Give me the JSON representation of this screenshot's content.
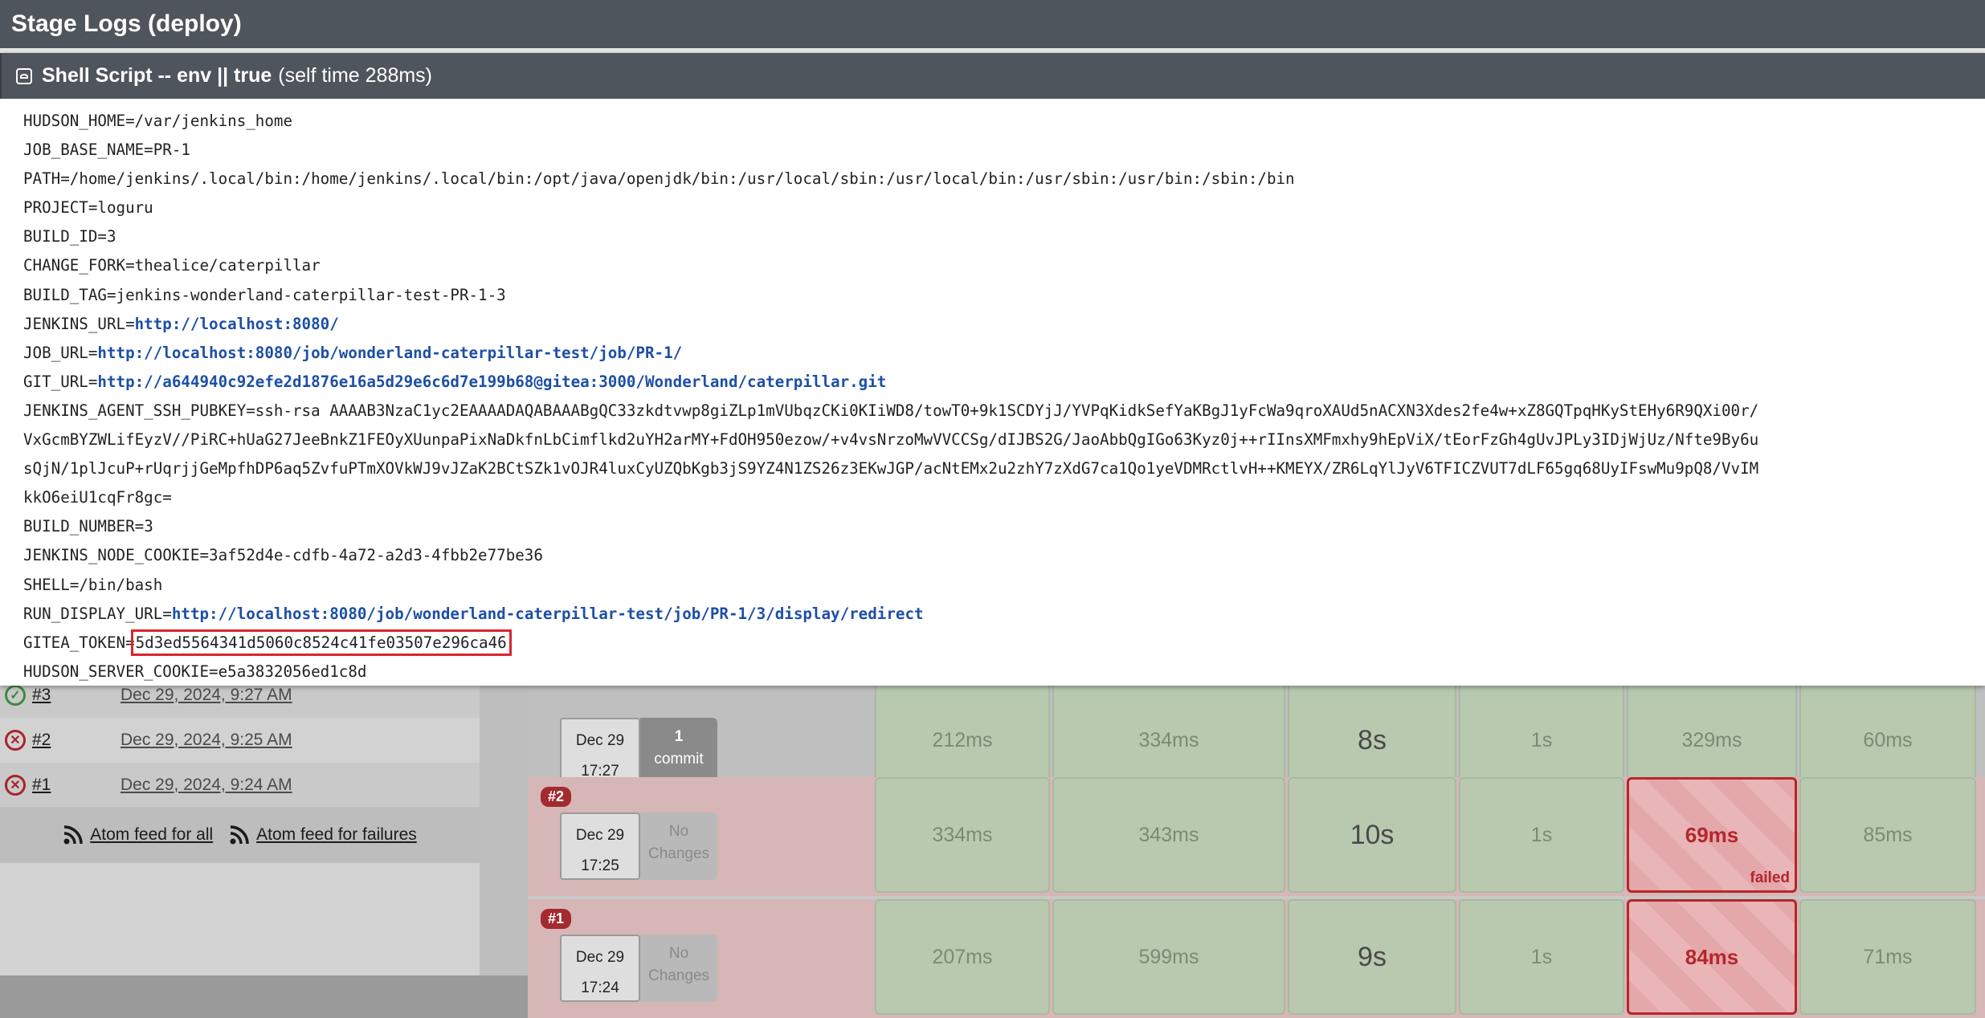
{
  "title": "Stage Logs (deploy)",
  "step": {
    "name": "Shell Script -- env || true",
    "time": "(self time 288ms)",
    "icon": "collapse-icon"
  },
  "log_lines": [
    {
      "key": "HUDSON_HOME=",
      "value": "/var/jenkins_home"
    },
    {
      "key": "JOB_BASE_NAME=",
      "value": "PR-1"
    },
    {
      "key": "PATH=",
      "value": "/home/jenkins/.local/bin:/home/jenkins/.local/bin:/opt/java/openjdk/bin:/usr/local/sbin:/usr/local/bin:/usr/sbin:/usr/bin:/sbin:/bin"
    },
    {
      "key": "PROJECT=",
      "value": "loguru"
    },
    {
      "key": "BUILD_ID=",
      "value": "3"
    },
    {
      "key": "CHANGE_FORK=",
      "value": "thealice/caterpillar"
    },
    {
      "key": "BUILD_TAG=",
      "value": "jenkins-wonderland-caterpillar-test-PR-1-3"
    },
    {
      "key": "JENKINS_URL=",
      "value": "http://localhost:8080/",
      "link": true
    },
    {
      "key": "JOB_URL=",
      "value": "http://localhost:8080/job/wonderland-caterpillar-test/job/PR-1/",
      "link": true
    },
    {
      "key": "GIT_URL=",
      "value": "http://a644940c92efe2d1876e16a5d29e6c6d7e199b68@gitea:3000/Wonderland/caterpillar.git",
      "link": true
    },
    {
      "key": "JENKINS_AGENT_SSH_PUBKEY=",
      "value": "ssh-rsa AAAAB3NzaC1yc2EAAAADAQABAAABgQC33zkdtvwp8giZLp1mVUbqzCKi0KIiWD8/towT0+9k1SCDYjJ/YVPqKidkSefYaKBgJ1yFcWa9qroXAUd5nACXN3Xdes2fe4w+xZ8GQTpqHKyStEHy6R9QXi00r/"
    },
    {
      "key": "",
      "value": "VxGcmBYZWLifEyzV//PiRC+hUaG27JeeBnkZ1FEOyXUunpaPixNaDkfnLbCimflkd2uYH2arMY+FdOH950ezow/+v4vsNrzoMwVVCCSg/dIJBS2G/JaoAbbQgIGo63Kyz0j++rIInsXMFmxhy9hEpViX/tEorFzGh4gUvJPLy3IDjWjUz/Nfte9By6u"
    },
    {
      "key": "",
      "value": "sQjN/1plJcuP+rUqrjjGeMpfhDP6aq5ZvfuPTmXOVkWJ9vJZaK2BCtSZk1vOJR4luxCyUZQbKgb3jS9YZ4N1ZS26z3EKwJGP/acNtEMx2u2zhY7zXdG7ca1Qo1yeVDMRctlvH++KMEYX/ZR6LqYlJyV6TFICZVUT7dLF65gq68UyIFswMu9pQ8/VvIM"
    },
    {
      "key": "",
      "value": "kkO6eiU1cqFr8gc="
    },
    {
      "key": "BUILD_NUMBER=",
      "value": "3"
    },
    {
      "key": "JENKINS_NODE_COOKIE=",
      "value": "3af52d4e-cdfb-4a72-a2d3-4fbb2e77be36"
    },
    {
      "key": "SHELL=",
      "value": "/bin/bash"
    },
    {
      "key": "RUN_DISPLAY_URL=",
      "value": "http://localhost:8080/job/wonderland-caterpillar-test/job/PR-1/3/display/redirect",
      "link": true
    },
    {
      "key": "GITEA_TOKEN=",
      "value": "5d3ed5564341d5060c8524c41fe03507e296ca46",
      "highlight": true
    },
    {
      "key": "HUDSON_SERVER_COOKIE=",
      "value": "e5a3832056ed1c8d"
    }
  ],
  "build_history": [
    {
      "num": "#3",
      "date": "Dec 29, 2024, 9:27 AM",
      "status": "success"
    },
    {
      "num": "#2",
      "date": "Dec 29, 2024, 9:25 AM",
      "status": "failed"
    },
    {
      "num": "#1",
      "date": "Dec 29, 2024, 9:24 AM",
      "status": "failed"
    }
  ],
  "feeds": {
    "all": "Atom feed for all",
    "failures": "Atom feed for failures"
  },
  "builds": [
    {
      "badge": "",
      "date": "Dec 29",
      "time": "17:27",
      "changes": [
        "1",
        "commit"
      ],
      "cells": [
        "212ms",
        "334ms",
        "8s",
        "1s",
        "329ms",
        "60ms"
      ],
      "failed_index": -1
    },
    {
      "badge": "#2",
      "date": "Dec 29",
      "time": "17:25",
      "changes": [
        "No",
        "Changes"
      ],
      "cells": [
        "334ms",
        "343ms",
        "10s",
        "1s",
        "69ms",
        "85ms"
      ],
      "failed_index": 4,
      "failed_label": "failed"
    },
    {
      "badge": "#1",
      "date": "Dec 29",
      "time": "17:24",
      "changes": [
        "No",
        "Changes"
      ],
      "cells": [
        "207ms",
        "599ms",
        "9s",
        "1s",
        "84ms",
        "71ms"
      ],
      "failed_index": 4
    }
  ]
}
